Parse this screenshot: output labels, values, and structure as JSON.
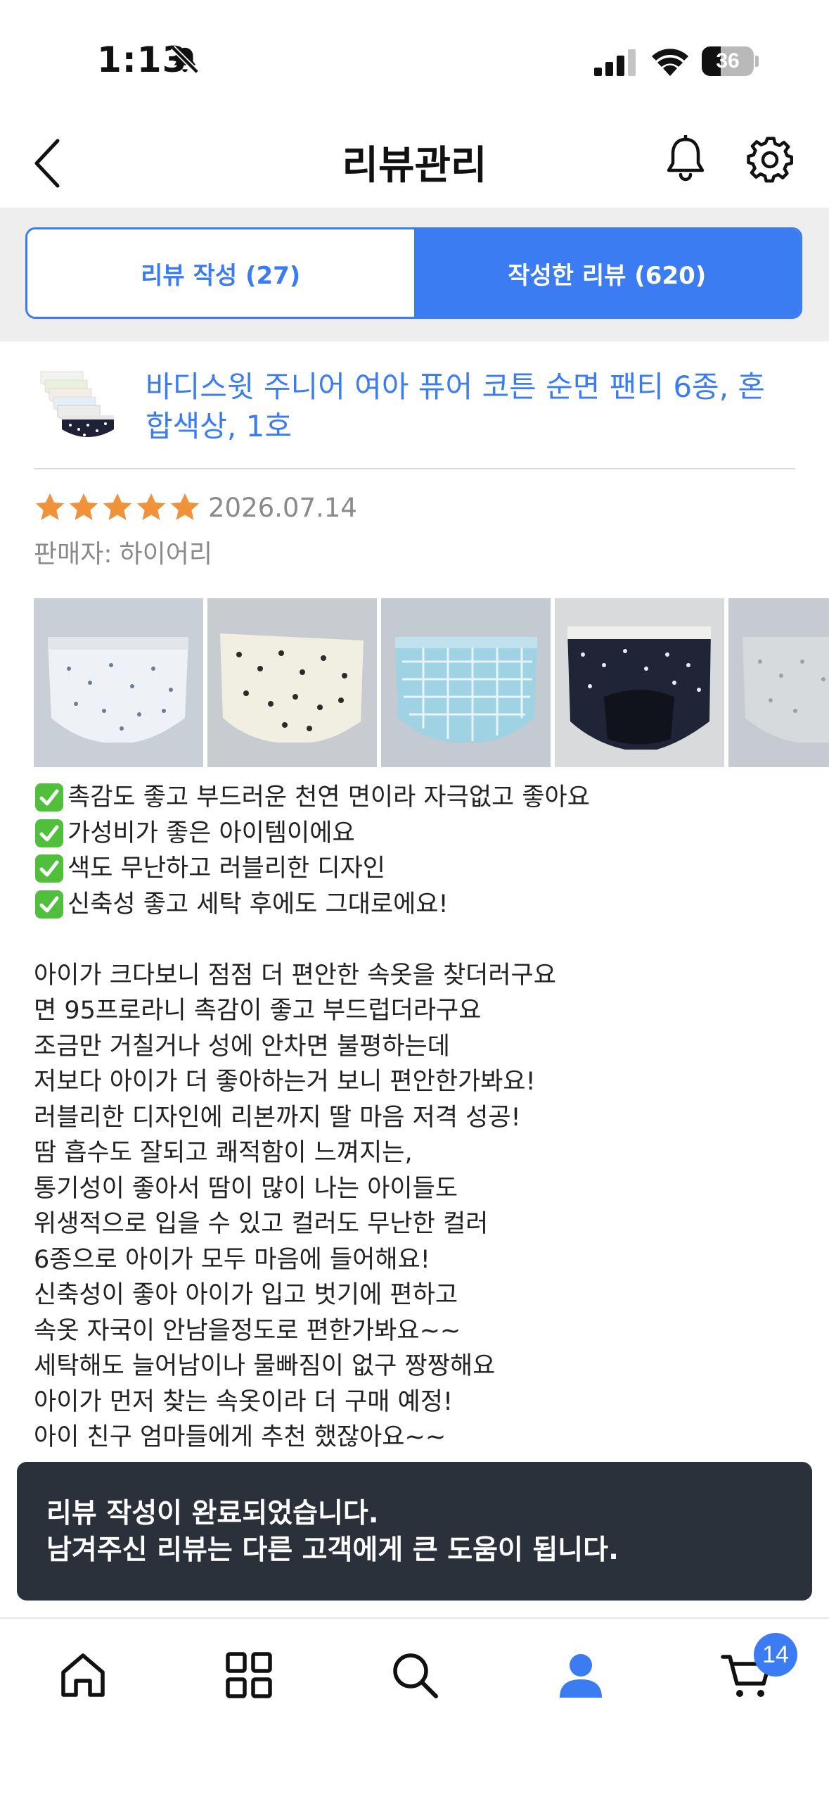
{
  "status_bar": {
    "time": "1:13",
    "battery": "36",
    "battery_level": 0.36,
    "icons": [
      "bell-slash-icon",
      "cellular-signal-icon",
      "wifi-icon",
      "battery-icon"
    ]
  },
  "header": {
    "title": "리뷰관리",
    "icons": [
      "back-chevron-icon",
      "bell-icon",
      "gear-icon"
    ]
  },
  "tabs": [
    {
      "label": "리뷰 작성 (27)",
      "active": false
    },
    {
      "label": "작성한 리뷰 (620)",
      "active": true
    }
  ],
  "product": {
    "name": "바디스윗 주니어 여아 퓨어 코튼 순면 팬티 6종, 혼합색상, 1호"
  },
  "review": {
    "rating": 5,
    "max_rating": 5,
    "date": "2026.07.14",
    "seller_label": "판매자:",
    "seller_name": "하이어리",
    "photo_count_visible": 5,
    "highlights": [
      "촉감도 좋고 부드러운 천연 면이라 자극없고 좋아요",
      "가성비가 좋은 아이템이에요",
      "색도 무난하고 러블리한 디자인",
      "신축성 좋고 세탁 후에도 그대로에요!"
    ],
    "body_lines": [
      "아이가 크다보니 점점 더 편안한 속옷을 찾더러구요",
      "면 95프로라니 촉감이 좋고 부드럽더라구요",
      "조금만 거칠거나 성에 안차면 불평하는데",
      "저보다 아이가 더 좋아하는거 보니 편안한가봐요!",
      "러블리한 디자인에 리본까지 딸 마음 저격 성공!",
      "땀 흡수도 잘되고 쾌적함이 느껴지는,",
      "통기성이 좋아서 땀이 많이 나는 아이들도",
      "위생적으로 입을 수 있고 컬러도 무난한 컬러",
      "6종으로 아이가 모두 마음에 들어해요!",
      "신축성이 좋아 아이가 입고 벗기에 편하고",
      "속옷 자국이 안남을정도로 편한가봐요~~",
      "세탁해도 늘어남이나 물빠짐이 없구 짱짱해요",
      "아이가 먼저 찾는 속옷이라 더 구매 예정!",
      "아이 친구 엄마들에게 추천 했잖아요~~"
    ]
  },
  "toast": {
    "line1": "리뷰 작성이 완료되었습니다.",
    "line2": "남겨주신 리뷰는 다른 고객에게 큰 도움이 됩니다."
  },
  "bottom_nav": {
    "items": [
      "home-icon",
      "categories-icon",
      "search-icon",
      "my-account-icon",
      "cart-icon"
    ],
    "active": "my-account-icon",
    "cart_count": "14"
  },
  "colors": {
    "accent": "#3b7cf2",
    "star": "#f0923a",
    "toast_bg": "#2a313b",
    "muted_text": "#8a8a8a"
  }
}
